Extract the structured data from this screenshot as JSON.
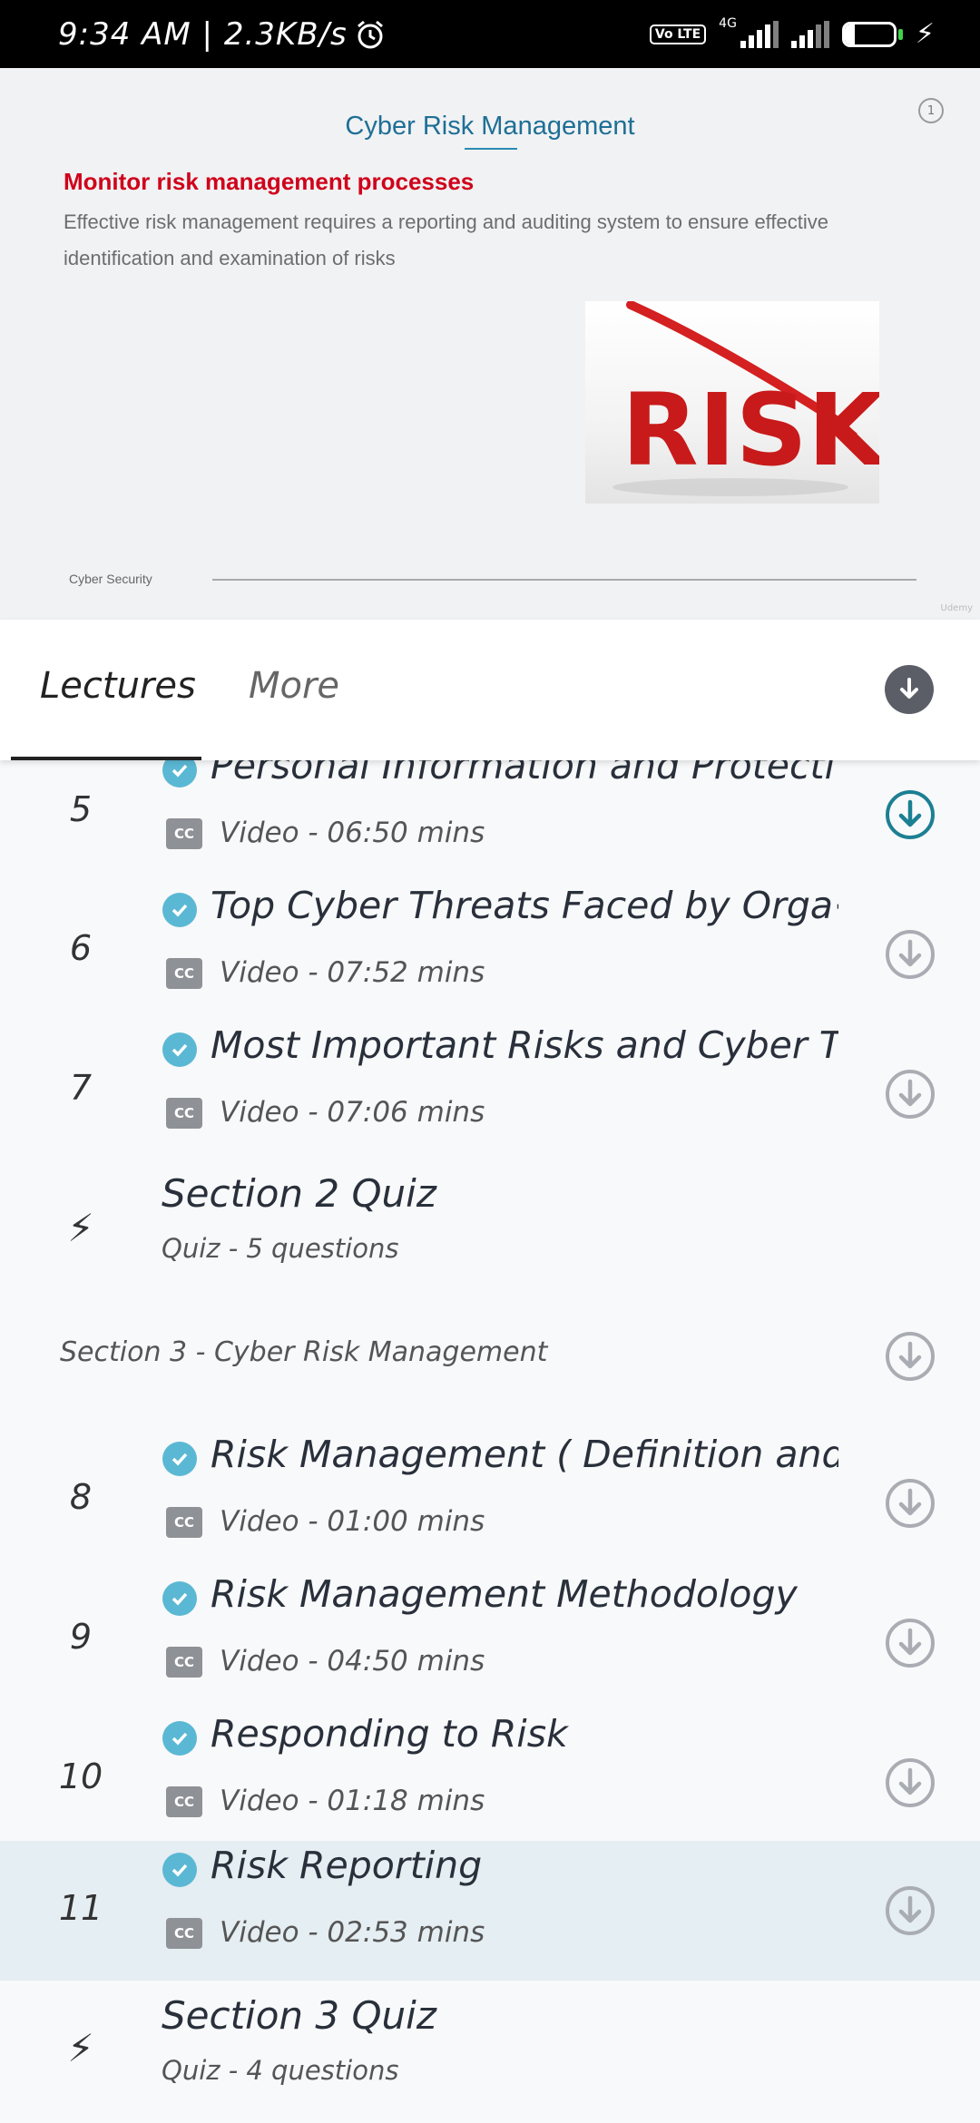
{
  "status_bar": {
    "time": "9:34 AM | 2.3KB/s",
    "volte": "Vo LTE",
    "network": "4G",
    "battery_percent": "21",
    "battery_level": 0.21
  },
  "slide": {
    "title": "Cyber Risk Management",
    "slide_number": "1",
    "heading": "Monitor risk management processes",
    "body": "Effective risk management requires a reporting and auditing system to ensure effective identification and examination of risks",
    "image_text": "RISK",
    "footer_label": "Cyber Security",
    "watermark": "Udemy"
  },
  "tabs": {
    "lectures": "Lectures",
    "more": "More"
  },
  "lectures": [
    {
      "number": "5",
      "title": "Personal Information and Protecti⋯",
      "meta": "Video - 06:50 mins"
    },
    {
      "number": "6",
      "title": "Top Cyber Threats Faced by Orga⋯",
      "meta": "Video - 07:52 mins"
    },
    {
      "number": "7",
      "title": "Most Important Risks and Cyber T⋯",
      "meta": "Video - 07:06 mins"
    }
  ],
  "quiz_2": {
    "title": "Section 2 Quiz",
    "meta": "Quiz - 5 questions"
  },
  "section_3": {
    "title": "Section 3 - Cyber Risk Management"
  },
  "lectures_section_3": [
    {
      "number": "8",
      "title": "Risk Management ( Definition and⋯",
      "meta": "Video - 01:00 mins"
    },
    {
      "number": "9",
      "title": "Risk Management Methodology",
      "meta": "Video - 04:50 mins"
    },
    {
      "number": "10",
      "title": "Responding to Risk",
      "meta": "Video - 01:18 mins"
    },
    {
      "number": "11",
      "title": "Risk Reporting",
      "meta": "Video - 02:53 mins"
    }
  ],
  "quiz_3": {
    "title": "Section 3 Quiz",
    "meta": "Quiz - 4 questions"
  },
  "colors": {
    "accent": "#1e6f96",
    "check": "#5bb8d4",
    "slide_heading": "#d0021b",
    "highlight_row": "#e5eef2",
    "download_active": "#1c7f93",
    "download_idle": "#a9adb3"
  },
  "icons": {
    "alarm": "alarm-icon",
    "signal": "signal-icon",
    "battery": "battery-icon",
    "charging": "charging-bolt-icon",
    "completed": "check-circle-icon",
    "captions": "cc-icon",
    "download": "download-icon",
    "quiz": "lightning-icon"
  }
}
